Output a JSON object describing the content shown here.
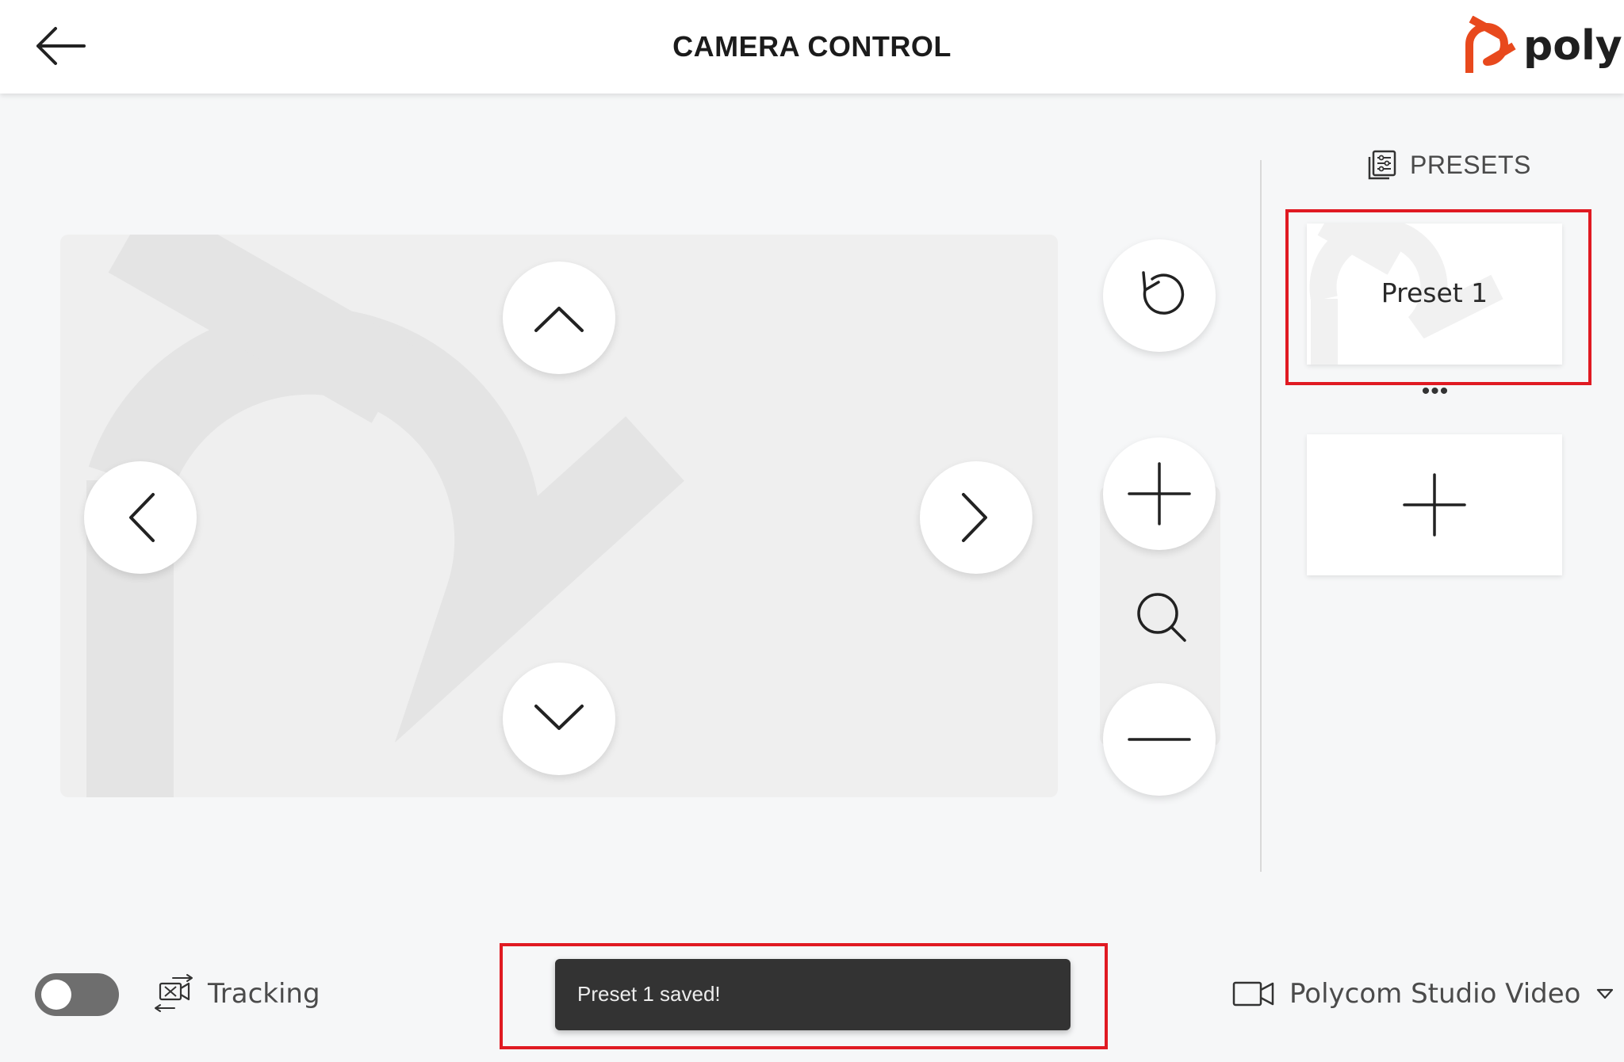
{
  "header": {
    "title": "CAMERA CONTROL",
    "logo_text": "poly",
    "brand_color": "#e8491d",
    "icons": {
      "back": "arrow-left-icon",
      "logo": "poly-logo-icon"
    }
  },
  "camera_view": {
    "watermark": "poly-watermark-icon",
    "controls": {
      "tilt_up": "chevron-up-icon",
      "tilt_down": "chevron-down-icon",
      "pan_left": "chevron-left-icon",
      "pan_right": "chevron-right-icon",
      "reset": "reset-icon",
      "zoom_in": "plus-icon",
      "zoom": "magnifier-icon",
      "zoom_out": "minus-icon"
    }
  },
  "presets": {
    "heading": "PRESETS",
    "heading_icon": "presets-list-icon",
    "items": [
      {
        "name": "Preset 1"
      }
    ],
    "more_label": "•••",
    "add_icon": "plus-icon"
  },
  "footer": {
    "tracking": {
      "label": "Tracking",
      "enabled": false,
      "icon": "tracking-icon"
    },
    "toast": {
      "message": "Preset 1 saved!"
    },
    "camera": {
      "label": "Polycom Studio Video",
      "icon": "video-camera-icon",
      "dropdown_icon": "caret-down-icon"
    }
  },
  "highlight_color": "#e01a22"
}
